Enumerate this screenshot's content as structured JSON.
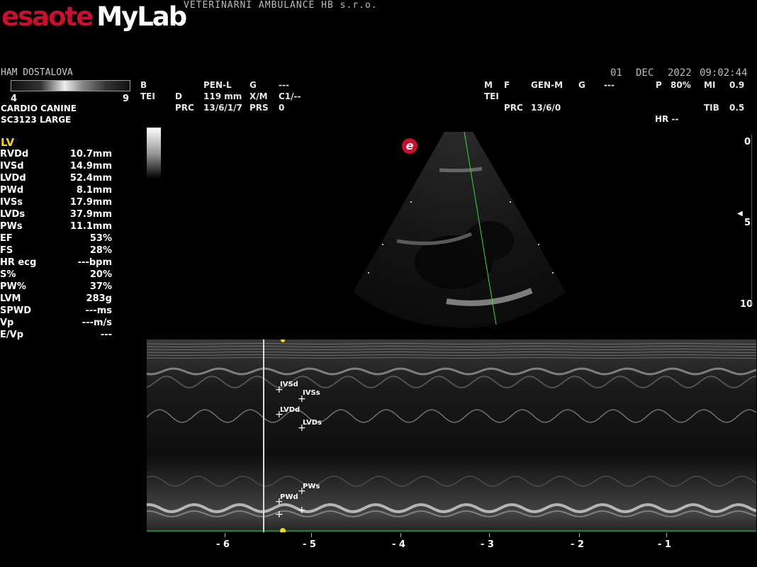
{
  "brand": {
    "logo_esaote": "esaote",
    "logo_mylab": "MyLab"
  },
  "clinic": "VETERINARNI AMBULANCE HB s.r.o.",
  "patient": {
    "name": "HAM DOSTALOVA",
    "preset": "CARDIO CANINE",
    "probe": "SC3123  LARGE"
  },
  "gray_scale": {
    "min": "4",
    "max": "9"
  },
  "datetime": {
    "day": "01",
    "month": "DEC",
    "year": "2022",
    "time": "09:02:44"
  },
  "b_params": {
    "row1": [
      "B",
      "PEN-L",
      "G",
      "---"
    ],
    "row2": [
      "TEI",
      "D",
      "119 mm",
      "X/M",
      "C1/--"
    ],
    "row3": [
      "PRC",
      "13/6/1/7",
      "PRS",
      "0"
    ]
  },
  "m_params": {
    "row1": [
      "M",
      "F",
      "GEN-M",
      "G",
      "---",
      "P",
      "80%",
      "MI",
      "0.9"
    ],
    "row2": [
      "TEI"
    ],
    "row3": [
      "PRC",
      "13/6/0",
      "TIB",
      "0.5"
    ],
    "hr": "HR --"
  },
  "depth_scale": [
    "0",
    "5",
    "10"
  ],
  "time_axis": [
    "- 6",
    "- 5",
    "- 4",
    "- 3",
    "- 2",
    "- 1"
  ],
  "measurements": {
    "title": "LV",
    "rows": [
      {
        "label": "RVDd",
        "value": "10.7mm"
      },
      {
        "label": "IVSd",
        "value": "14.9mm"
      },
      {
        "label": "LVDd",
        "value": "52.4mm"
      },
      {
        "label": "PWd",
        "value": "8.1mm"
      },
      {
        "label": "IVSs",
        "value": "17.9mm"
      },
      {
        "label": "LVDs",
        "value": "37.9mm"
      },
      {
        "label": "PWs",
        "value": "11.1mm"
      },
      {
        "label": "EF",
        "value": "53%"
      },
      {
        "label": "FS",
        "value": "28%"
      },
      {
        "label": "HR ecg",
        "value": "---bpm"
      },
      {
        "label": "S%",
        "value": "20%"
      },
      {
        "label": "PW%",
        "value": "37%"
      },
      {
        "label": "LVM",
        "value": "283g"
      },
      {
        "label": "SPWD",
        "value": "---ms"
      },
      {
        "label": "Vp",
        "value": "---m/s"
      },
      {
        "label": "E/Vp",
        "value": "---"
      }
    ]
  },
  "caliper_labels": [
    "IVSd",
    "IVSs",
    "LVDd",
    "LVDs",
    "PWs",
    "PWd"
  ],
  "sector_icon": "e",
  "colors": {
    "logo_red": "#c8102e",
    "mline": "#33dd33",
    "ecg": "#2ecc40",
    "marker": "#f5d90a",
    "lv_title": "#f5d90a"
  }
}
